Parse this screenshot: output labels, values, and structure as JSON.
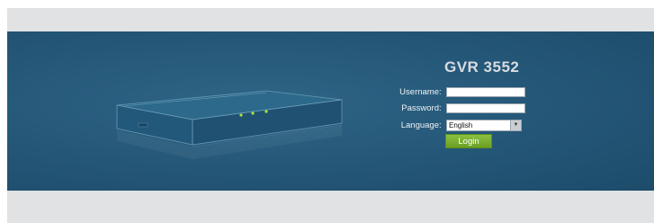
{
  "product": {
    "title": "GVR 3552"
  },
  "login_form": {
    "username_label": "Username",
    "password_label": "Password",
    "language_label": "Language",
    "colon": ":",
    "username_value": "",
    "password_value": "",
    "language_selected": "English",
    "login_button_label": "Login"
  },
  "colors": {
    "panel_background": "#245677",
    "login_button": "#6a9f22",
    "band_gray": "#e0e2e4"
  },
  "icons": {
    "device": "network-video-recorder-illustration",
    "dropdown": "chevron-down-icon"
  }
}
